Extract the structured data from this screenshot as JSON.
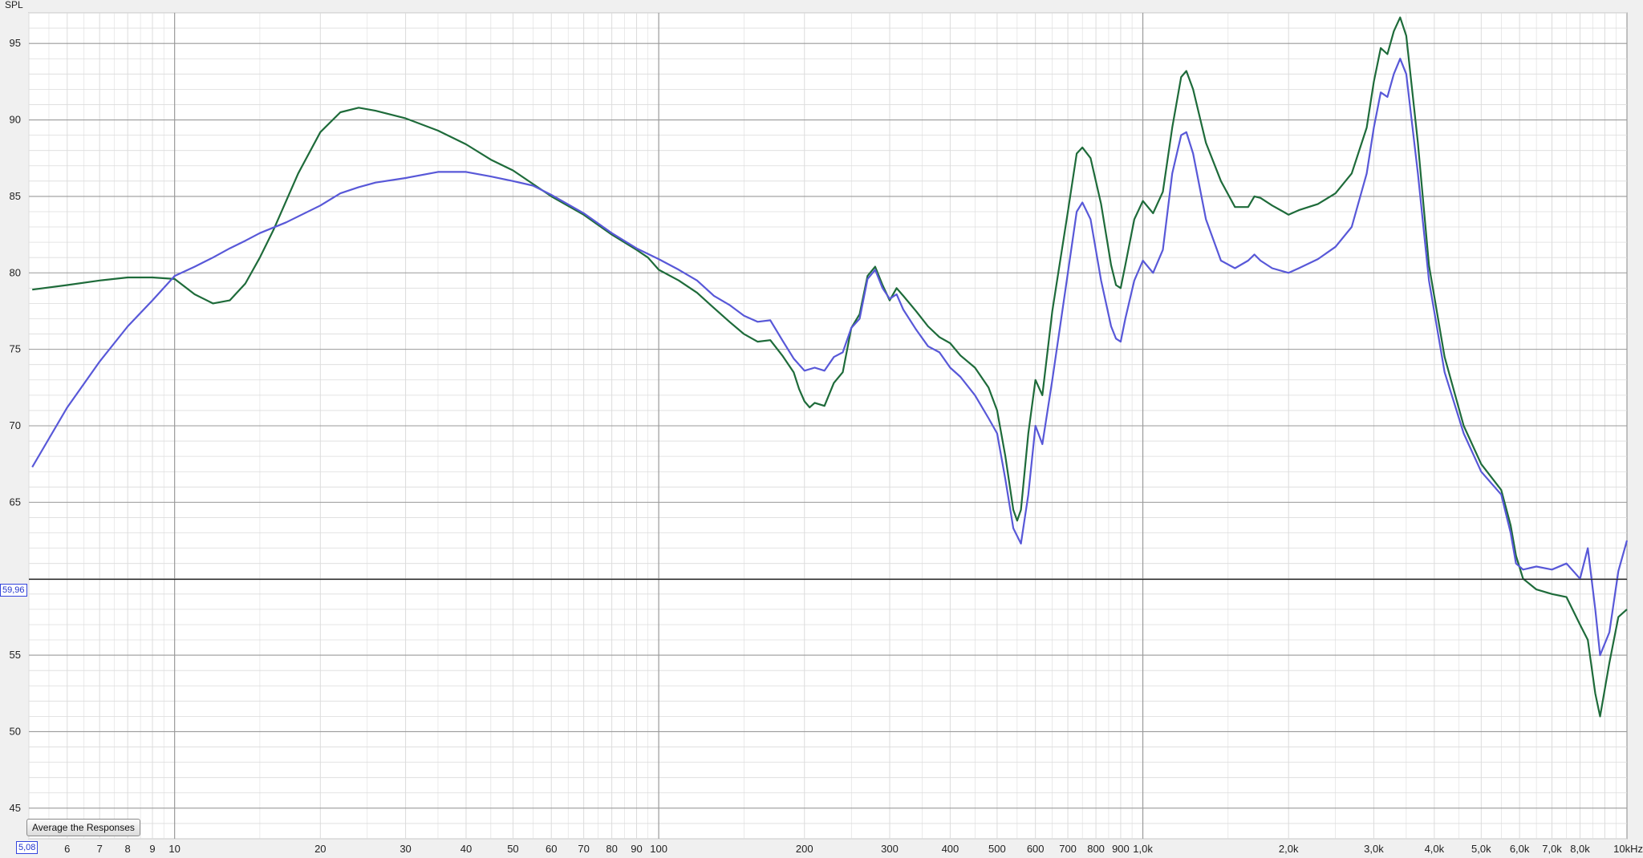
{
  "colors": {
    "plot_background": "#ffffff",
    "major_grid": "#9a9a9a",
    "minor_grid": "#dcdcdc",
    "cursor_line": "#222222",
    "readout": "#2233cc"
  },
  "controls": {
    "average_button": "Average the Responses"
  },
  "cursor": {
    "y_value_label": "59,96",
    "x_value_label": "5,08",
    "y_value": 59.96
  },
  "chart_data": {
    "type": "line",
    "title": "",
    "ylabel": "SPL",
    "xlabel": "",
    "x_scale": "log",
    "xlim": [
      5,
      10000
    ],
    "ylim": [
      43,
      97
    ],
    "grid": true,
    "x_ticks": [
      {
        "v": 5.08,
        "label": ""
      },
      {
        "v": 6,
        "label": "6"
      },
      {
        "v": 7,
        "label": "7"
      },
      {
        "v": 8,
        "label": "8"
      },
      {
        "v": 9,
        "label": "9"
      },
      {
        "v": 10,
        "label": "10"
      },
      {
        "v": 20,
        "label": "20"
      },
      {
        "v": 30,
        "label": "30"
      },
      {
        "v": 40,
        "label": "40"
      },
      {
        "v": 50,
        "label": "50"
      },
      {
        "v": 60,
        "label": "60"
      },
      {
        "v": 70,
        "label": "70"
      },
      {
        "v": 80,
        "label": "80"
      },
      {
        "v": 90,
        "label": "90"
      },
      {
        "v": 100,
        "label": "100"
      },
      {
        "v": 200,
        "label": "200"
      },
      {
        "v": 300,
        "label": "300"
      },
      {
        "v": 400,
        "label": "400"
      },
      {
        "v": 500,
        "label": "500"
      },
      {
        "v": 600,
        "label": "600"
      },
      {
        "v": 700,
        "label": "700"
      },
      {
        "v": 800,
        "label": "800"
      },
      {
        "v": 900,
        "label": "900"
      },
      {
        "v": 1000,
        "label": "1,0k"
      },
      {
        "v": 2000,
        "label": "2,0k"
      },
      {
        "v": 3000,
        "label": "3,0k"
      },
      {
        "v": 4000,
        "label": "4,0k"
      },
      {
        "v": 5000,
        "label": "5,0k"
      },
      {
        "v": 6000,
        "label": "6,0k"
      },
      {
        "v": 7000,
        "label": "7,0k"
      },
      {
        "v": 8000,
        "label": "8,0k"
      },
      {
        "v": 10000,
        "label": "10kHz"
      }
    ],
    "y_ticks": [
      {
        "v": 45,
        "label": "45"
      },
      {
        "v": 50,
        "label": "50"
      },
      {
        "v": 55,
        "label": "55"
      },
      {
        "v": 60,
        "label": ""
      },
      {
        "v": 65,
        "label": "65"
      },
      {
        "v": 70,
        "label": "70"
      },
      {
        "v": 75,
        "label": "75"
      },
      {
        "v": 80,
        "label": "80"
      },
      {
        "v": 85,
        "label": "85"
      },
      {
        "v": 90,
        "label": "90"
      },
      {
        "v": 95,
        "label": "95"
      }
    ],
    "series": [
      {
        "color": "#1e6b3a",
        "points": [
          [
            5.08,
            78.9
          ],
          [
            6,
            79.2
          ],
          [
            7,
            79.5
          ],
          [
            8,
            79.7
          ],
          [
            9,
            79.7
          ],
          [
            10,
            79.6
          ],
          [
            11,
            78.6
          ],
          [
            12,
            78.0
          ],
          [
            13,
            78.2
          ],
          [
            14,
            79.3
          ],
          [
            15,
            81
          ],
          [
            16,
            82.8
          ],
          [
            17,
            84.7
          ],
          [
            18,
            86.5
          ],
          [
            20,
            89.2
          ],
          [
            22,
            90.5
          ],
          [
            24,
            90.8
          ],
          [
            26,
            90.6
          ],
          [
            30,
            90.1
          ],
          [
            35,
            89.3
          ],
          [
            40,
            88.4
          ],
          [
            45,
            87.4
          ],
          [
            50,
            86.7
          ],
          [
            60,
            85.0
          ],
          [
            70,
            83.8
          ],
          [
            80,
            82.5
          ],
          [
            90,
            81.5
          ],
          [
            95,
            81.0
          ],
          [
            100,
            80.2
          ],
          [
            110,
            79.5
          ],
          [
            120,
            78.7
          ],
          [
            130,
            77.7
          ],
          [
            140,
            76.8
          ],
          [
            150,
            76.0
          ],
          [
            160,
            75.5
          ],
          [
            170,
            75.6
          ],
          [
            180,
            74.6
          ],
          [
            190,
            73.5
          ],
          [
            195,
            72.4
          ],
          [
            200,
            71.6
          ],
          [
            205,
            71.2
          ],
          [
            210,
            71.5
          ],
          [
            220,
            71.3
          ],
          [
            230,
            72.8
          ],
          [
            240,
            73.5
          ],
          [
            250,
            76.4
          ],
          [
            260,
            77.3
          ],
          [
            270,
            79.8
          ],
          [
            280,
            80.4
          ],
          [
            290,
            79.2
          ],
          [
            300,
            78.2
          ],
          [
            310,
            79.0
          ],
          [
            320,
            78.5
          ],
          [
            340,
            77.5
          ],
          [
            360,
            76.5
          ],
          [
            380,
            75.8
          ],
          [
            400,
            75.4
          ],
          [
            420,
            74.6
          ],
          [
            450,
            73.8
          ],
          [
            480,
            72.5
          ],
          [
            500,
            71.0
          ],
          [
            520,
            68.0
          ],
          [
            540,
            64.5
          ],
          [
            550,
            63.8
          ],
          [
            560,
            64.5
          ],
          [
            580,
            69.5
          ],
          [
            600,
            73.0
          ],
          [
            620,
            72.0
          ],
          [
            650,
            77.5
          ],
          [
            700,
            84.0
          ],
          [
            730,
            87.8
          ],
          [
            750,
            88.2
          ],
          [
            780,
            87.5
          ],
          [
            820,
            84.5
          ],
          [
            860,
            80.5
          ],
          [
            880,
            79.2
          ],
          [
            900,
            79.0
          ],
          [
            920,
            80.5
          ],
          [
            960,
            83.5
          ],
          [
            1000,
            84.7
          ],
          [
            1050,
            83.9
          ],
          [
            1100,
            85.3
          ],
          [
            1150,
            89.5
          ],
          [
            1200,
            92.8
          ],
          [
            1230,
            93.2
          ],
          [
            1270,
            92.0
          ],
          [
            1350,
            88.5
          ],
          [
            1450,
            86.0
          ],
          [
            1550,
            84.3
          ],
          [
            1650,
            84.3
          ],
          [
            1700,
            85.0
          ],
          [
            1750,
            84.9
          ],
          [
            1850,
            84.4
          ],
          [
            1950,
            84.0
          ],
          [
            2000,
            83.8
          ],
          [
            2100,
            84.1
          ],
          [
            2300,
            84.5
          ],
          [
            2500,
            85.2
          ],
          [
            2700,
            86.5
          ],
          [
            2900,
            89.5
          ],
          [
            3000,
            92.5
          ],
          [
            3100,
            94.7
          ],
          [
            3200,
            94.3
          ],
          [
            3300,
            95.8
          ],
          [
            3400,
            96.7
          ],
          [
            3500,
            95.5
          ],
          [
            3700,
            88.5
          ],
          [
            3900,
            80.5
          ],
          [
            4200,
            74.5
          ],
          [
            4600,
            70.0
          ],
          [
            5000,
            67.5
          ],
          [
            5500,
            65.8
          ],
          [
            5750,
            63.5
          ],
          [
            5900,
            61.5
          ],
          [
            6100,
            60.0
          ],
          [
            6500,
            59.3
          ],
          [
            7000,
            59.0
          ],
          [
            7500,
            58.8
          ],
          [
            8000,
            57.0
          ],
          [
            8300,
            56.0
          ],
          [
            8600,
            52.5
          ],
          [
            8800,
            51.0
          ],
          [
            9200,
            54.5
          ],
          [
            9600,
            57.5
          ],
          [
            10000,
            58.0
          ]
        ]
      },
      {
        "color": "#5858d8",
        "points": [
          [
            5.08,
            67.3
          ],
          [
            6,
            71.2
          ],
          [
            7,
            74.2
          ],
          [
            8,
            76.5
          ],
          [
            9,
            78.2
          ],
          [
            10,
            79.8
          ],
          [
            11,
            80.4
          ],
          [
            12,
            81.0
          ],
          [
            13,
            81.6
          ],
          [
            14,
            82.1
          ],
          [
            15,
            82.6
          ],
          [
            17,
            83.3
          ],
          [
            20,
            84.4
          ],
          [
            22,
            85.2
          ],
          [
            24,
            85.6
          ],
          [
            26,
            85.9
          ],
          [
            30,
            86.2
          ],
          [
            35,
            86.6
          ],
          [
            40,
            86.6
          ],
          [
            45,
            86.3
          ],
          [
            50,
            86.0
          ],
          [
            55,
            85.7
          ],
          [
            60,
            85.1
          ],
          [
            70,
            83.9
          ],
          [
            80,
            82.6
          ],
          [
            90,
            81.6
          ],
          [
            100,
            80.9
          ],
          [
            110,
            80.2
          ],
          [
            120,
            79.5
          ],
          [
            130,
            78.5
          ],
          [
            140,
            77.9
          ],
          [
            150,
            77.2
          ],
          [
            160,
            76.8
          ],
          [
            170,
            76.9
          ],
          [
            180,
            75.6
          ],
          [
            190,
            74.4
          ],
          [
            200,
            73.6
          ],
          [
            210,
            73.8
          ],
          [
            220,
            73.6
          ],
          [
            230,
            74.5
          ],
          [
            240,
            74.8
          ],
          [
            250,
            76.4
          ],
          [
            260,
            77.0
          ],
          [
            270,
            79.6
          ],
          [
            280,
            80.2
          ],
          [
            290,
            79.0
          ],
          [
            300,
            78.3
          ],
          [
            310,
            78.6
          ],
          [
            320,
            77.6
          ],
          [
            340,
            76.3
          ],
          [
            360,
            75.2
          ],
          [
            380,
            74.8
          ],
          [
            400,
            73.8
          ],
          [
            420,
            73.2
          ],
          [
            450,
            72.0
          ],
          [
            480,
            70.5
          ],
          [
            500,
            69.5
          ],
          [
            520,
            66.5
          ],
          [
            540,
            63.3
          ],
          [
            560,
            62.3
          ],
          [
            580,
            65.5
          ],
          [
            600,
            70.0
          ],
          [
            620,
            68.8
          ],
          [
            650,
            73.0
          ],
          [
            700,
            80.0
          ],
          [
            730,
            84.0
          ],
          [
            750,
            84.6
          ],
          [
            780,
            83.5
          ],
          [
            820,
            79.5
          ],
          [
            860,
            76.5
          ],
          [
            880,
            75.7
          ],
          [
            900,
            75.5
          ],
          [
            920,
            77.0
          ],
          [
            960,
            79.5
          ],
          [
            1000,
            80.8
          ],
          [
            1050,
            80.0
          ],
          [
            1100,
            81.5
          ],
          [
            1150,
            86.5
          ],
          [
            1200,
            89.0
          ],
          [
            1230,
            89.2
          ],
          [
            1270,
            87.8
          ],
          [
            1350,
            83.5
          ],
          [
            1450,
            80.8
          ],
          [
            1550,
            80.3
          ],
          [
            1650,
            80.8
          ],
          [
            1700,
            81.2
          ],
          [
            1750,
            80.8
          ],
          [
            1850,
            80.3
          ],
          [
            2000,
            80.0
          ],
          [
            2100,
            80.3
          ],
          [
            2300,
            80.9
          ],
          [
            2500,
            81.7
          ],
          [
            2700,
            83.0
          ],
          [
            2900,
            86.5
          ],
          [
            3000,
            89.5
          ],
          [
            3100,
            91.8
          ],
          [
            3200,
            91.5
          ],
          [
            3300,
            93.0
          ],
          [
            3400,
            94.0
          ],
          [
            3500,
            93.0
          ],
          [
            3700,
            86.5
          ],
          [
            3900,
            79.5
          ],
          [
            4200,
            73.5
          ],
          [
            4600,
            69.5
          ],
          [
            5000,
            67.0
          ],
          [
            5500,
            65.5
          ],
          [
            5750,
            63.0
          ],
          [
            5900,
            61.0
          ],
          [
            6100,
            60.6
          ],
          [
            6500,
            60.8
          ],
          [
            7000,
            60.6
          ],
          [
            7500,
            61.0
          ],
          [
            8000,
            60.0
          ],
          [
            8300,
            62.0
          ],
          [
            8600,
            58.0
          ],
          [
            8800,
            55.0
          ],
          [
            9200,
            56.5
          ],
          [
            9600,
            60.5
          ],
          [
            10000,
            62.5
          ]
        ]
      }
    ]
  }
}
